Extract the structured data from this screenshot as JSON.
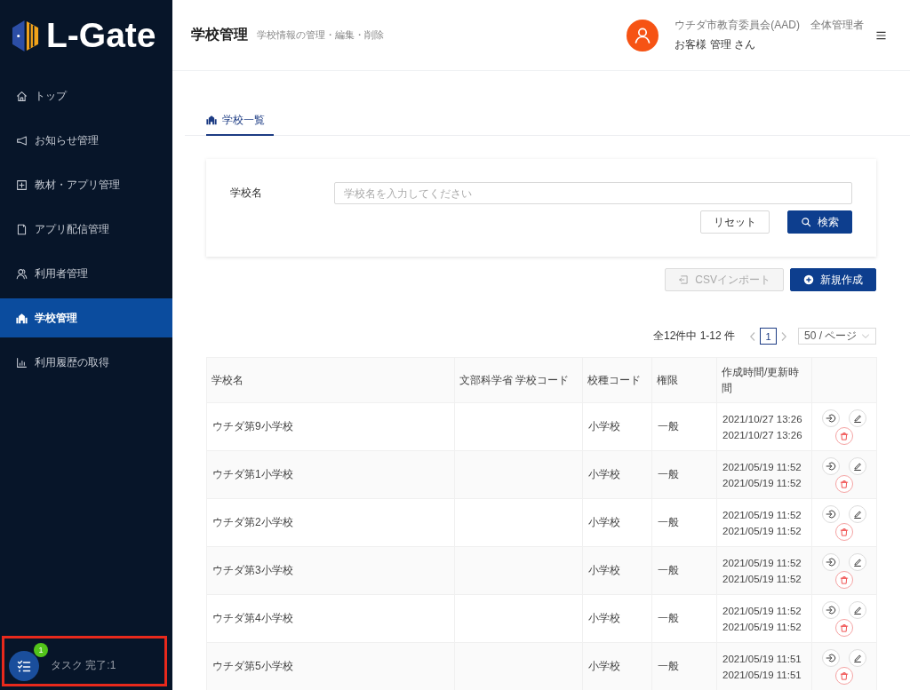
{
  "sidebar": {
    "logo": {
      "text": "L-Gate"
    },
    "items": [
      {
        "label": "トップ",
        "kind": "home",
        "selected": false
      },
      {
        "label": "お知らせ管理",
        "kind": "announce",
        "selected": false
      },
      {
        "label": "教材・アプリ管理",
        "kind": "materials",
        "selected": false
      },
      {
        "label": "アプリ配信管理",
        "kind": "delivery",
        "selected": false
      },
      {
        "label": "利用者管理",
        "kind": "users",
        "selected": false
      },
      {
        "label": "学校管理",
        "kind": "school",
        "selected": true
      },
      {
        "label": "利用履歴の取得",
        "kind": "usage",
        "selected": false
      }
    ],
    "task_widget": {
      "badge": "1",
      "label": "タスク 完了:1",
      "highlighted": true
    }
  },
  "header": {
    "title": "学校管理",
    "subtitle": "学校情報の管理・編集・削除",
    "user": {
      "organization": "ウチダ市教育委員会(AAD)",
      "role": "全体管理者",
      "name": "お客様 管理 さん"
    }
  },
  "tabs": [
    {
      "label": "学校一覧",
      "selected": true
    }
  ],
  "search": {
    "label": "学校名",
    "placeholder": "学校名を入力してください",
    "buttons": [
      {
        "label": "リセット",
        "kind": "reset"
      },
      {
        "label": "検索",
        "kind": "search"
      }
    ]
  },
  "actions": [
    {
      "label": "CSVインポート",
      "kind": "import",
      "disabled": true
    },
    {
      "label": "新規作成",
      "kind": "create",
      "disabled": false
    }
  ],
  "pagination": {
    "summary": "全12件中 1-12 件",
    "pages": [
      {
        "label": "1",
        "selected": true
      }
    ],
    "page_size": "50 / ページ"
  },
  "table": {
    "columns": [
      "学校名",
      "文部科学省 学校コード",
      "校種コード",
      "権限",
      "作成時間/更新時間"
    ],
    "rows": [
      {
        "name": "ウチダ第9小学校",
        "school_type": "小学校",
        "authority": "一般",
        "created": "2021/10/27 13:26",
        "updated": "2021/10/27 13:26"
      },
      {
        "name": "ウチダ第1小学校",
        "school_type": "小学校",
        "authority": "一般",
        "created": "2021/05/19 11:52",
        "updated": "2021/05/19 11:52"
      },
      {
        "name": "ウチダ第2小学校",
        "school_type": "小学校",
        "authority": "一般",
        "created": "2021/05/19 11:52",
        "updated": "2021/05/19 11:52"
      },
      {
        "name": "ウチダ第3小学校",
        "school_type": "小学校",
        "authority": "一般",
        "created": "2021/05/19 11:52",
        "updated": "2021/05/19 11:52"
      },
      {
        "name": "ウチダ第4小学校",
        "school_type": "小学校",
        "authority": "一般",
        "created": "2021/05/19 11:52",
        "updated": "2021/05/19 11:52"
      },
      {
        "name": "ウチダ第5小学校",
        "school_type": "小学校",
        "authority": "一般",
        "created": "2021/05/19 11:51",
        "updated": "2021/05/19 11:51"
      }
    ]
  }
}
